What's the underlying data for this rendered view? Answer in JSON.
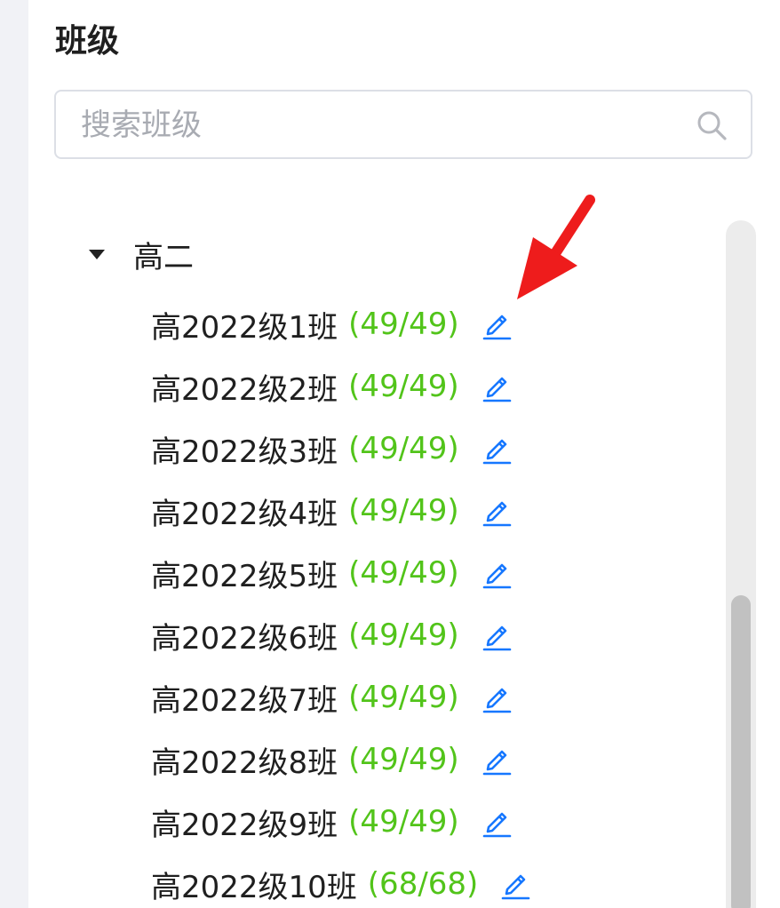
{
  "panel": {
    "title": "班级",
    "search": {
      "placeholder": "搜索班级",
      "value": ""
    }
  },
  "tree": {
    "group": {
      "label": "高二",
      "expanded": true
    },
    "classes": [
      {
        "name": "高2022级1班",
        "count": "(49/49)"
      },
      {
        "name": "高2022级2班",
        "count": "(49/49)"
      },
      {
        "name": "高2022级3班",
        "count": "(49/49)"
      },
      {
        "name": "高2022级4班",
        "count": "(49/49)"
      },
      {
        "name": "高2022级5班",
        "count": "(49/49)"
      },
      {
        "name": "高2022级6班",
        "count": "(49/49)"
      },
      {
        "name": "高2022级7班",
        "count": "(49/49)"
      },
      {
        "name": "高2022级8班",
        "count": "(49/49)"
      },
      {
        "name": "高2022级9班",
        "count": "(49/49)"
      },
      {
        "name": "高2022级10班",
        "count": "(68/68)"
      }
    ]
  },
  "icons": {
    "search": "search-icon",
    "edit": "edit-icon",
    "caret": "caret-down-icon",
    "annotation": "red-arrow-icon"
  },
  "colors": {
    "count": "#52c41a",
    "edit": "#1677ff",
    "arrow": "#ee1c1c"
  }
}
